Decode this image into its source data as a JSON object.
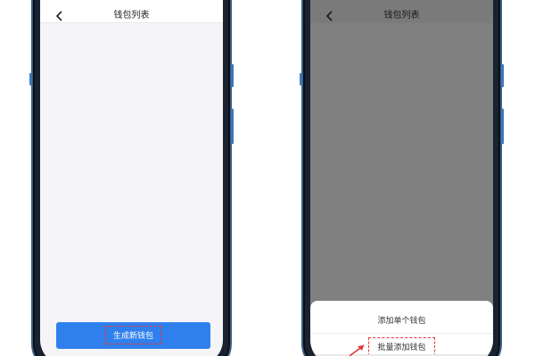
{
  "left_phone": {
    "title": "钱包列表",
    "back_icon": "chevron-left-icon",
    "primary_button_label": "生成新钱包"
  },
  "right_phone": {
    "title": "钱包列表",
    "back_icon": "chevron-left-icon",
    "sheet_items": [
      {
        "label": "添加单个钱包"
      },
      {
        "label": "批量添加钱包"
      }
    ]
  },
  "colors": {
    "primary": "#2f80ed",
    "annotation": "#e33333",
    "overlay": "#808080",
    "frame": "#3b5f86"
  }
}
